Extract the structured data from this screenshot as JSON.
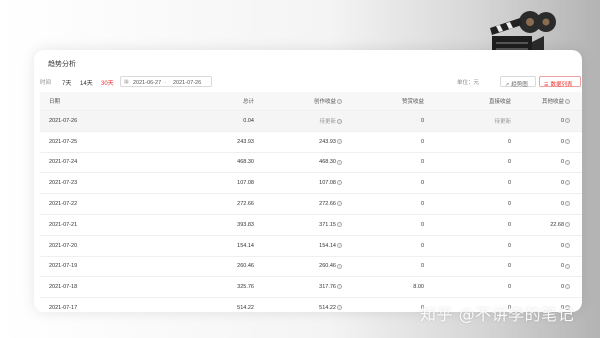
{
  "title": "趋势分析",
  "toolbar": {
    "period_label": "时间",
    "chips": [
      "7天",
      "14天",
      "30天"
    ],
    "active_chip": "30天",
    "date_start": "2021-06-27",
    "date_sep": "-",
    "date_end": "2021-07-26",
    "unit_label": "单位：元",
    "trend_button": "趋势图",
    "list_button": "数据列表"
  },
  "table": {
    "headers": [
      "日期",
      "总计",
      "创作收益",
      "赞赏收益",
      "直接收益",
      "其他收益"
    ],
    "rows": [
      [
        "2021-07-26",
        "0.04",
        "待更新",
        "0",
        "待更新",
        "0"
      ],
      [
        "2021-07-25",
        "243.93",
        "243.93",
        "0",
        "0",
        "0"
      ],
      [
        "2021-07-24",
        "468.30",
        "468.30",
        "0",
        "0",
        "0"
      ],
      [
        "2021-07-23",
        "107.08",
        "107.08",
        "0",
        "0",
        "0"
      ],
      [
        "2021-07-22",
        "272.66",
        "272.66",
        "0",
        "0",
        "0"
      ],
      [
        "2021-07-21",
        "393.83",
        "371.15",
        "0",
        "0",
        "22.68"
      ],
      [
        "2021-07-20",
        "154.14",
        "154.14",
        "0",
        "0",
        "0"
      ],
      [
        "2021-07-19",
        "260.46",
        "260.46",
        "0",
        "0",
        "0"
      ],
      [
        "2021-07-18",
        "325.76",
        "317.76",
        "8.00",
        "0",
        "0"
      ],
      [
        "2021-07-17",
        "514.22",
        "514.22",
        "0",
        "0",
        "0"
      ]
    ]
  },
  "watermark": "知乎 @不讲李的笔记",
  "colors": {
    "accent": "#e33333",
    "header_bg": "#f7f7f7",
    "border": "#efefef"
  },
  "icons": [
    "clapperboard-icon",
    "calendar-icon",
    "trend-chart-icon",
    "list-icon",
    "help-circle-icon"
  ]
}
